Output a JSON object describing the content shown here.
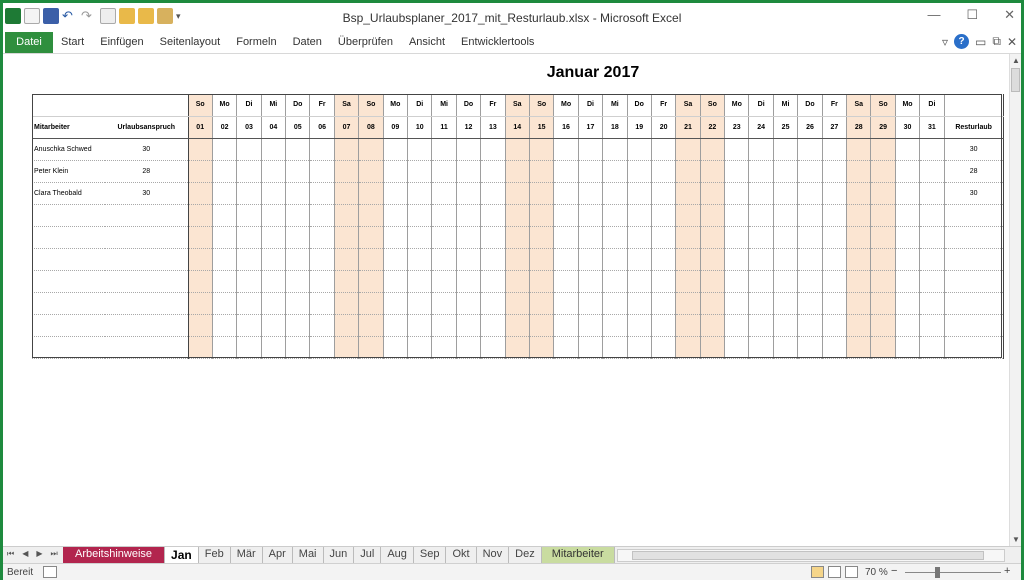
{
  "window": {
    "title": "Bsp_Urlaubsplaner_2017_mit_Resturlaub.xlsx - Microsoft Excel",
    "minimize": "—",
    "maximize": "☐",
    "close": "✕"
  },
  "ribbon": {
    "file_tab": "Datei",
    "tabs": [
      "Start",
      "Einfügen",
      "Seitenlayout",
      "Formeln",
      "Daten",
      "Überprüfen",
      "Ansicht",
      "Entwicklertools"
    ],
    "help": "?"
  },
  "sheet": {
    "title": "Januar 2017",
    "header": {
      "employee": "Mitarbeiter",
      "claim": "Urlaubsanspruch",
      "rest": "Resturlaub"
    },
    "days": [
      {
        "wd": "So",
        "d": "01",
        "we": true
      },
      {
        "wd": "Mo",
        "d": "02",
        "we": false
      },
      {
        "wd": "Di",
        "d": "03",
        "we": false
      },
      {
        "wd": "Mi",
        "d": "04",
        "we": false
      },
      {
        "wd": "Do",
        "d": "05",
        "we": false
      },
      {
        "wd": "Fr",
        "d": "06",
        "we": false
      },
      {
        "wd": "Sa",
        "d": "07",
        "we": true
      },
      {
        "wd": "So",
        "d": "08",
        "we": true
      },
      {
        "wd": "Mo",
        "d": "09",
        "we": false
      },
      {
        "wd": "Di",
        "d": "10",
        "we": false
      },
      {
        "wd": "Mi",
        "d": "11",
        "we": false
      },
      {
        "wd": "Do",
        "d": "12",
        "we": false
      },
      {
        "wd": "Fr",
        "d": "13",
        "we": false
      },
      {
        "wd": "Sa",
        "d": "14",
        "we": true
      },
      {
        "wd": "So",
        "d": "15",
        "we": true
      },
      {
        "wd": "Mo",
        "d": "16",
        "we": false
      },
      {
        "wd": "Di",
        "d": "17",
        "we": false
      },
      {
        "wd": "Mi",
        "d": "18",
        "we": false
      },
      {
        "wd": "Do",
        "d": "19",
        "we": false
      },
      {
        "wd": "Fr",
        "d": "20",
        "we": false
      },
      {
        "wd": "Sa",
        "d": "21",
        "we": true
      },
      {
        "wd": "So",
        "d": "22",
        "we": true
      },
      {
        "wd": "Mo",
        "d": "23",
        "we": false
      },
      {
        "wd": "Di",
        "d": "24",
        "we": false
      },
      {
        "wd": "Mi",
        "d": "25",
        "we": false
      },
      {
        "wd": "Do",
        "d": "26",
        "we": false
      },
      {
        "wd": "Fr",
        "d": "27",
        "we": false
      },
      {
        "wd": "Sa",
        "d": "28",
        "we": true
      },
      {
        "wd": "So",
        "d": "29",
        "we": true
      },
      {
        "wd": "Mo",
        "d": "30",
        "we": false
      },
      {
        "wd": "Di",
        "d": "31",
        "we": false
      }
    ],
    "rows": [
      {
        "name": "Anuschka Schwed",
        "claim": "30",
        "rest": "30"
      },
      {
        "name": "Peter Klein",
        "claim": "28",
        "rest": "28"
      },
      {
        "name": "Clara Theobald",
        "claim": "30",
        "rest": "30"
      },
      {
        "name": "",
        "claim": "",
        "rest": ""
      },
      {
        "name": "",
        "claim": "",
        "rest": ""
      },
      {
        "name": "",
        "claim": "",
        "rest": ""
      },
      {
        "name": "",
        "claim": "",
        "rest": ""
      },
      {
        "name": "",
        "claim": "",
        "rest": ""
      },
      {
        "name": "",
        "claim": "",
        "rest": ""
      },
      {
        "name": "",
        "claim": "",
        "rest": ""
      }
    ]
  },
  "sheet_tabs": [
    "Arbeitshinweise",
    "Jan",
    "Feb",
    "Mär",
    "Apr",
    "Mai",
    "Jun",
    "Jul",
    "Aug",
    "Sep",
    "Okt",
    "Nov",
    "Dez",
    "Mitarbeiter"
  ],
  "active_tab": "Jan",
  "status": {
    "ready": "Bereit",
    "zoom": "70 %",
    "zoom_minus": "−",
    "zoom_plus": "+"
  },
  "colors": {
    "frame": "#1e8a3e",
    "weekend": "#fbe5d2",
    "arbeitshinweise_tab": "#b2254e",
    "mitarbeiter_tab": "#c9dca0"
  }
}
